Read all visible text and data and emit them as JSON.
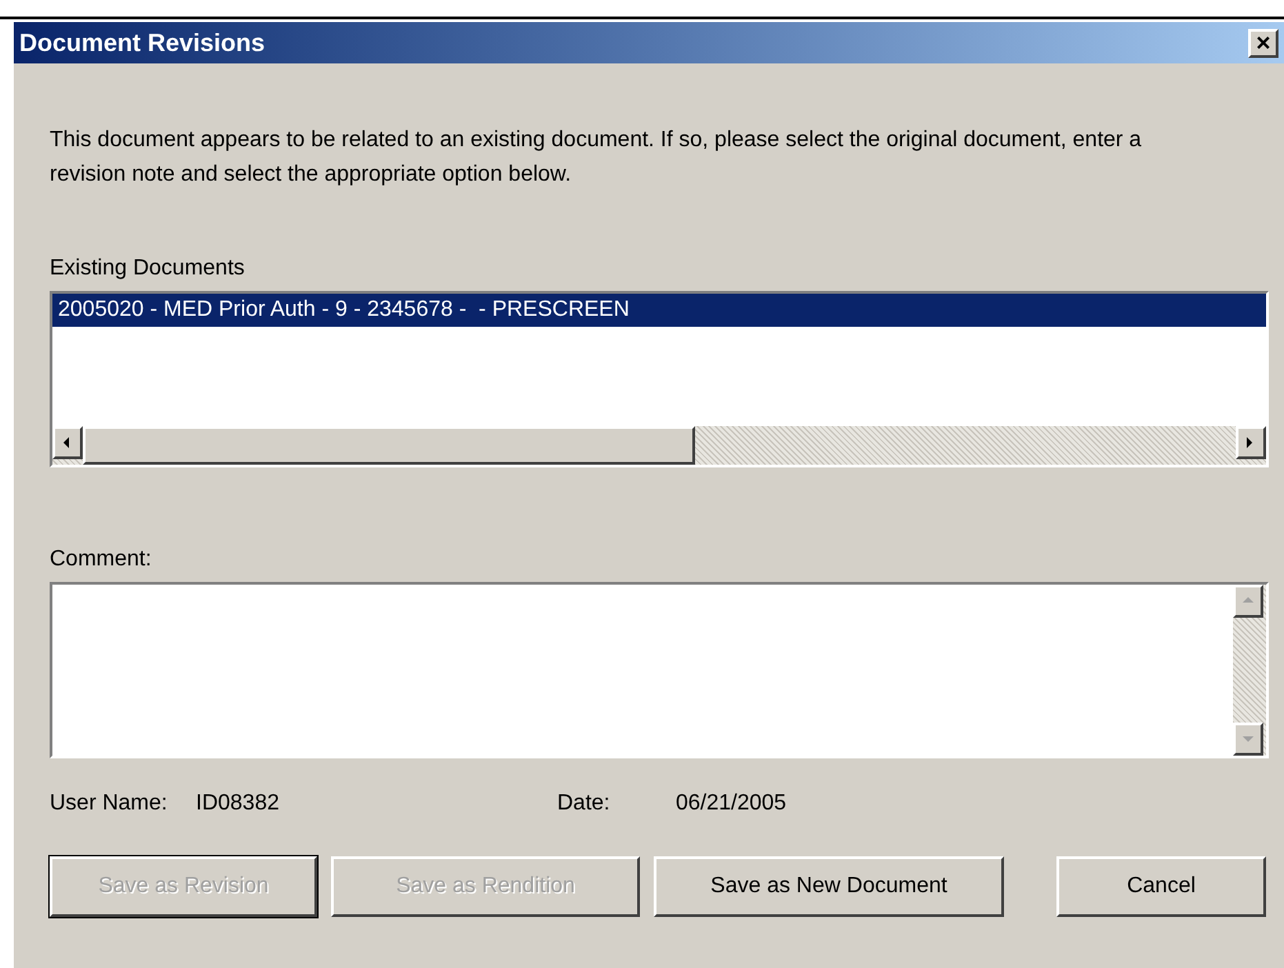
{
  "window": {
    "title": "Document Revisions",
    "close": "×"
  },
  "intro": "This document appears to be related to an existing document. If so, please select the original document, enter a revision note and select the appropriate option below.",
  "existing_documents": {
    "label": "Existing Documents",
    "items": [
      {
        "text": "2005020 - MED Prior Auth - 9 - 2345678 -  - PRESCREEN",
        "selected": true
      }
    ]
  },
  "comment": {
    "label": "Comment:"
  },
  "user_name": {
    "label": "User Name:",
    "value": "ID08382"
  },
  "date": {
    "label": "Date:",
    "value": "06/21/2005"
  },
  "buttons": [
    {
      "label": "Save as Revision",
      "disabled": true,
      "default": true
    },
    {
      "label": "Save as Rendition",
      "disabled": true,
      "default": false
    },
    {
      "label": "Save as New Document",
      "disabled": false,
      "default": false
    },
    {
      "label": "Cancel",
      "disabled": false,
      "default": false
    }
  ]
}
